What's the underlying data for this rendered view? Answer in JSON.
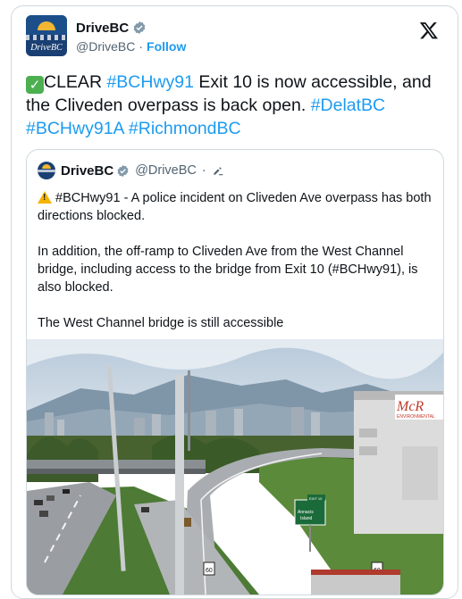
{
  "author": {
    "display_name": "DriveBC",
    "handle": "@DriveBC",
    "separator": "·",
    "follow_label": "Follow",
    "avatar_brand": "DriveBC"
  },
  "tweet": {
    "status": "CLEAR",
    "tag1": "#BCHwy91",
    "text1": " Exit 10 is now accessible, and the Cliveden overpass is back open. ",
    "tag2": "#DelatBC",
    "tag3": "#BCHwy91A",
    "tag4": "#RichmondBC"
  },
  "quoted": {
    "display_name": "DriveBC",
    "handle": "@DriveBC",
    "separator": "·",
    "para1": " #BCHwy91 -  A police incident on Cliveden Ave overpass has both directions blocked.",
    "para2": "In addition, the off-ramp to Cliveden Ave from the West Channel bridge, including access to the bridge from Exit 10 (#BCHwy91), is also blocked.",
    "para3": "The West Channel bridge is still accessible"
  },
  "photo": {
    "sign_exit": "EXIT 10",
    "sign_dest1": "Annacis",
    "sign_dest2": "Island",
    "speed1": "60",
    "speed2": "60",
    "building_logo": "McR",
    "building_sub": "ENVIRONMENTAL"
  },
  "colors": {
    "link": "#1d9bf0",
    "text": "#0f1419",
    "muted": "#536471",
    "verified": "#829aab",
    "sky": "#c9d8e6",
    "grass": "#3e6b2a"
  },
  "icons": [
    "x-logo-icon",
    "verified-badge-icon",
    "check-mark-emoji",
    "warning-emoji",
    "edit-pencil-icon"
  ]
}
